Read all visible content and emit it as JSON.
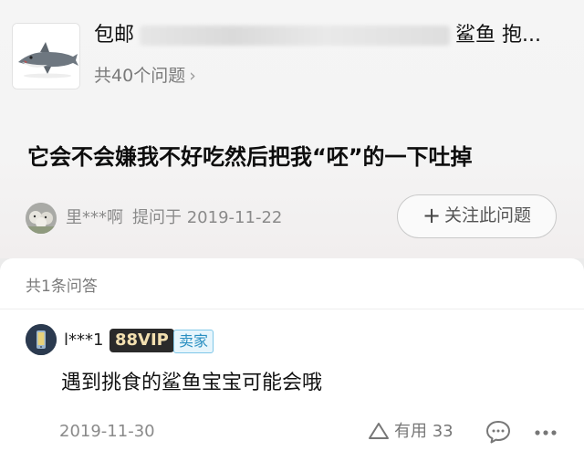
{
  "product": {
    "title_start": "包邮",
    "title_end": "鲨鱼 抱...",
    "title_obscured": "VillageVanguard Chumbuddy",
    "question_count_prefix": "共",
    "question_count": "40",
    "question_count_suffix": "个问题",
    "chevron": "›"
  },
  "question": {
    "text": "它会不会嫌我不好吃然后把我“呸”的一下吐掉",
    "asker_name": "里***啊",
    "asked_label": "提问于",
    "asked_date": "2019-11-22",
    "follow_plus": "+",
    "follow_label": "关注此问题"
  },
  "answers": {
    "count_label": "共1条问答",
    "items": [
      {
        "name": "l***1",
        "vip_badge": "88VIP",
        "role_badge": "卖家",
        "text": "遇到挑食的鲨鱼宝宝可能会哦",
        "date": "2019-11-30",
        "useful_label": "有用",
        "useful_count": "33"
      }
    ]
  },
  "icons": {
    "product_thumbnail": "shark-plush-image",
    "asker_avatar": "sheep-avatar",
    "answerer_avatar": "phone-avatar",
    "useful": "triangle-up-icon",
    "comment": "comment-bubble-icon",
    "more": "more-dots-icon"
  },
  "colors": {
    "seller_badge": "#2a8fc1",
    "vip_badge_bg": "#2a2a2a",
    "vip_badge_text": "#f3e0b0"
  }
}
